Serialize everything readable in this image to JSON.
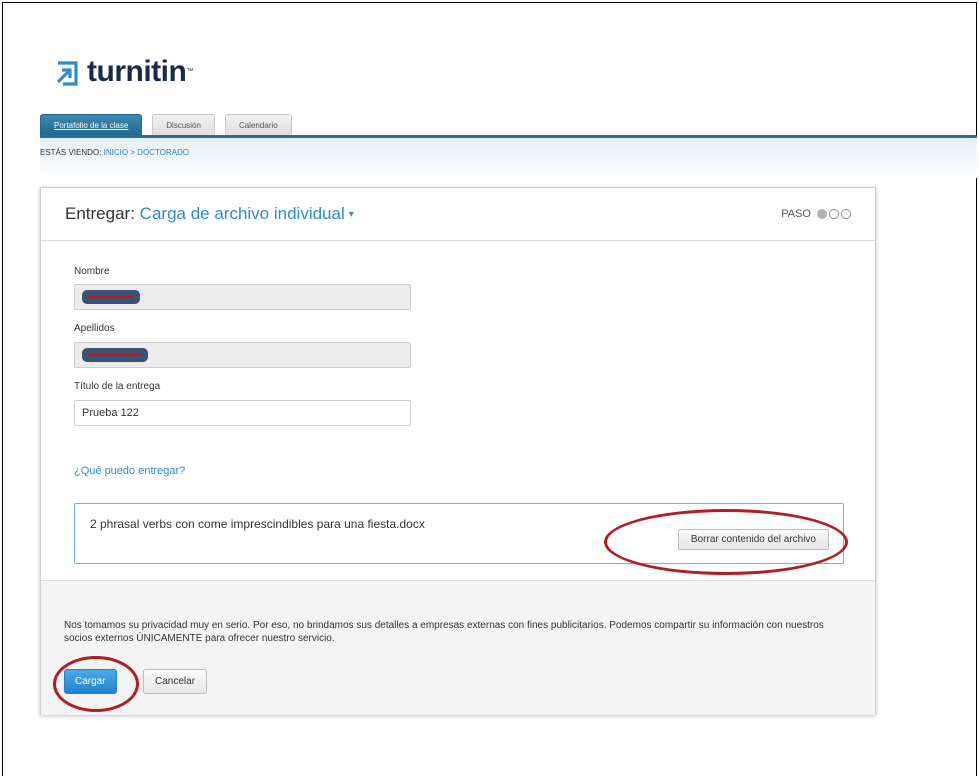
{
  "brand": {
    "name": "turnitin",
    "tm": "™",
    "color": "#1a2b45",
    "accent": "#2f8bd0"
  },
  "tabs": [
    {
      "label": "Portafolio de la clase",
      "active": true
    },
    {
      "label": "Discusión",
      "active": false
    },
    {
      "label": "Calendario",
      "active": false
    }
  ],
  "breadcrumb": {
    "prefix": "ESTÁS VIENDO:",
    "home": "INICIO",
    "sep": " > ",
    "current": "DOCTORADO"
  },
  "card": {
    "title": "Entregar:",
    "submode": "Carga de archivo individual",
    "caret": "▾",
    "steps_label": "PASO",
    "steps_total": 3,
    "steps_current": 1
  },
  "form": {
    "first_name_label": "Nombre",
    "last_name_label": "Apellidos",
    "submission_title_label": "Título de la entrega",
    "submission_title_value": "Prueba 122",
    "help_link": "¿Qué puedo entregar?",
    "file_name": "2 phrasal verbs con come imprescindibles para una fiesta.docx",
    "clear_button": "Borrar contenido del archivo"
  },
  "footer": {
    "privacy_text": "Nos tomamos su privacidad muy en serio. Por eso, no brindamos sus detalles a empresas externas con fines publicitarios. Podemos compartir su información con nuestros socios externos ÚNICAMENTE para ofrecer nuestro servicio.",
    "upload_button": "Cargar",
    "cancel_button": "Cancelar"
  }
}
